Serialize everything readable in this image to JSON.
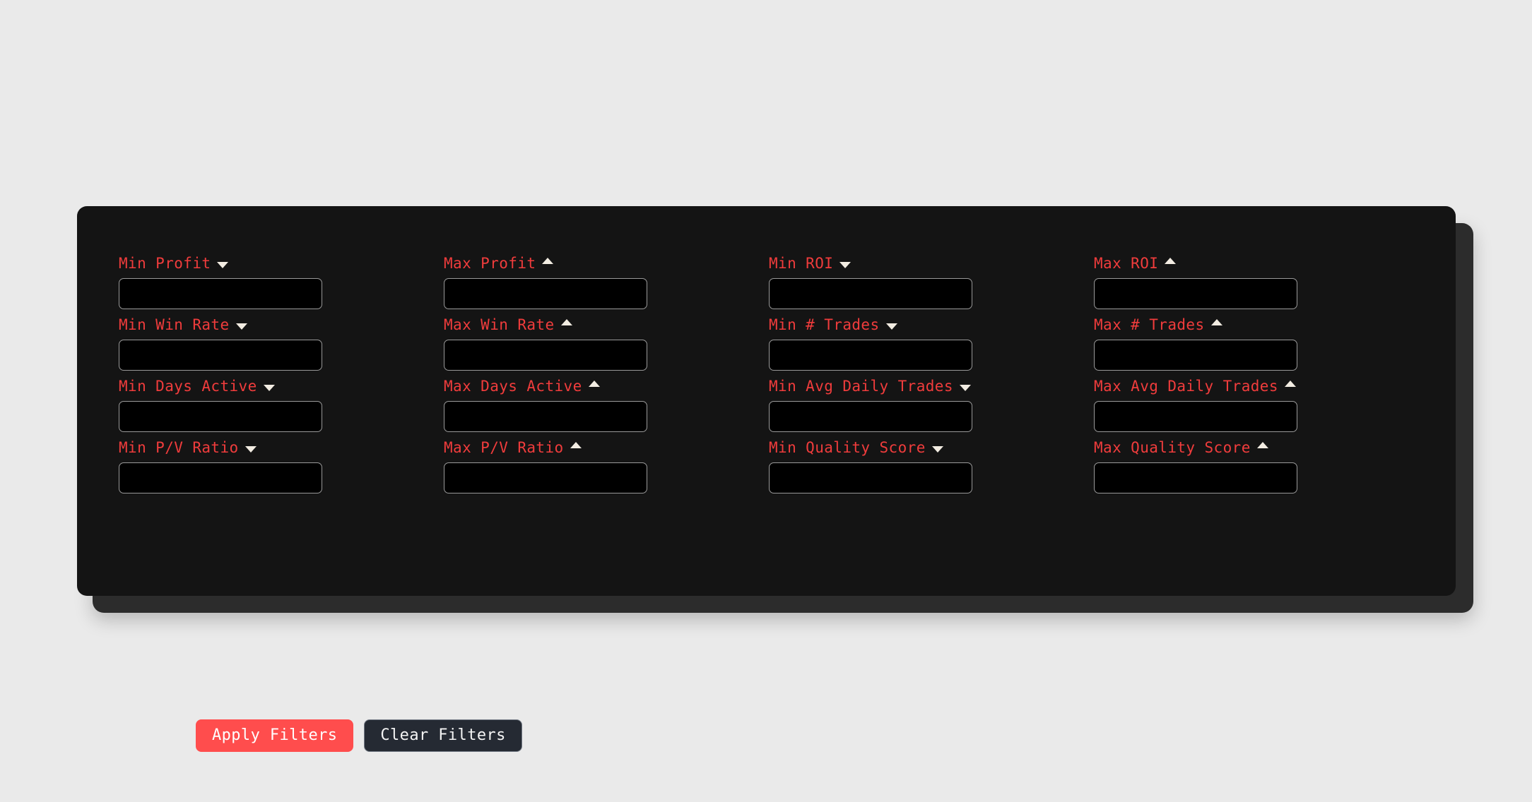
{
  "panel": {
    "background_color": "#141414",
    "backdrop_color": "#2c2c2c",
    "page_background": "#eaeaea",
    "label_color": "#f03c3c",
    "input_border_color": "#9a9a9a",
    "input_background": "#000000",
    "arrow_color": "#f2ece2"
  },
  "filters": [
    {
      "label": "Min Profit",
      "arrow": "down",
      "value": "",
      "placeholder": ""
    },
    {
      "label": "Max Profit",
      "arrow": "up",
      "value": "",
      "placeholder": ""
    },
    {
      "label": "Min ROI",
      "arrow": "down",
      "value": "",
      "placeholder": ""
    },
    {
      "label": "Max ROI",
      "arrow": "up",
      "value": "",
      "placeholder": ""
    },
    {
      "label": "Min Win Rate",
      "arrow": "down",
      "value": "",
      "placeholder": ""
    },
    {
      "label": "Max Win Rate",
      "arrow": "up",
      "value": "",
      "placeholder": ""
    },
    {
      "label": "Min # Trades",
      "arrow": "down",
      "value": "",
      "placeholder": ""
    },
    {
      "label": "Max # Trades",
      "arrow": "up",
      "value": "",
      "placeholder": ""
    },
    {
      "label": "Min Days Active",
      "arrow": "down",
      "value": "",
      "placeholder": ""
    },
    {
      "label": "Max Days Active",
      "arrow": "up",
      "value": "",
      "placeholder": ""
    },
    {
      "label": "Min Avg Daily Trades",
      "arrow": "down",
      "value": "",
      "placeholder": ""
    },
    {
      "label": "Max Avg Daily Trades",
      "arrow": "up",
      "value": "",
      "placeholder": ""
    },
    {
      "label": "Min P/V Ratio",
      "arrow": "down",
      "value": "",
      "placeholder": ""
    },
    {
      "label": "Max P/V Ratio",
      "arrow": "up",
      "value": "",
      "placeholder": ""
    },
    {
      "label": "Min Quality Score",
      "arrow": "down",
      "value": "",
      "placeholder": ""
    },
    {
      "label": "Max Quality Score",
      "arrow": "up",
      "value": "",
      "placeholder": ""
    }
  ],
  "actions": {
    "apply_label": "Apply Filters",
    "clear_label": "Clear Filters",
    "apply_color": "#ff4d4d",
    "clear_color": "#252a33"
  }
}
